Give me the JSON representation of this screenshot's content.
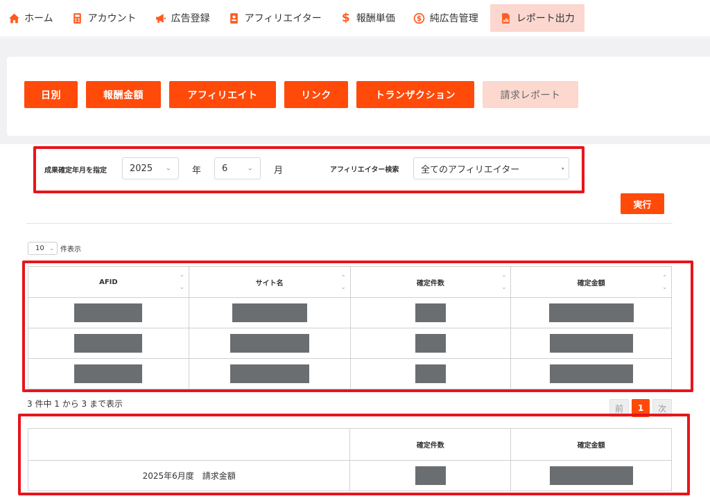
{
  "nav": [
    {
      "icon": "home-icon",
      "glyph": "⌂",
      "label": "ホーム"
    },
    {
      "icon": "calculator-icon",
      "glyph": "▦",
      "label": "アカウント"
    },
    {
      "icon": "megaphone-icon",
      "glyph": "◀",
      "label": "広告登録"
    },
    {
      "icon": "id-badge-icon",
      "glyph": "▣",
      "label": "アフィリエイター"
    },
    {
      "icon": "dollar-icon",
      "glyph": "$",
      "label": "報酬単価"
    },
    {
      "icon": "coin-icon",
      "glyph": "$",
      "label": "純広告管理"
    },
    {
      "icon": "report-file-icon",
      "glyph": "▤",
      "label": "レポート出力"
    }
  ],
  "tabs": [
    "日別",
    "報酬金額",
    "アフィリエイト",
    "リンク",
    "トランザクション",
    "請求レポート"
  ],
  "filter": {
    "period_label": "成果確定年月を指定",
    "year_value": "2025",
    "year_unit": "年",
    "month_value": "6",
    "month_unit": "月",
    "affiliator_label": "アフィリエイター検索",
    "affiliator_value": "全てのアフィリエイター"
  },
  "run_label": "実行",
  "page_size": {
    "value": "10",
    "label": "件表示"
  },
  "table": {
    "columns": [
      "AFID",
      "サイト名",
      "確定件数",
      "確定金額"
    ],
    "rows": 3
  },
  "info_text": "3 件中 1 から 3 まで表示",
  "pagination": {
    "prev": "前",
    "current": "1",
    "next": "次"
  },
  "summary": {
    "columns": [
      "",
      "確定件数",
      "確定金額"
    ],
    "row_label": "2025年6月度　請求金額"
  },
  "colors": {
    "accent": "#ff4a0a",
    "highlight": "#e8141c",
    "redacted": "#6b6e70"
  }
}
